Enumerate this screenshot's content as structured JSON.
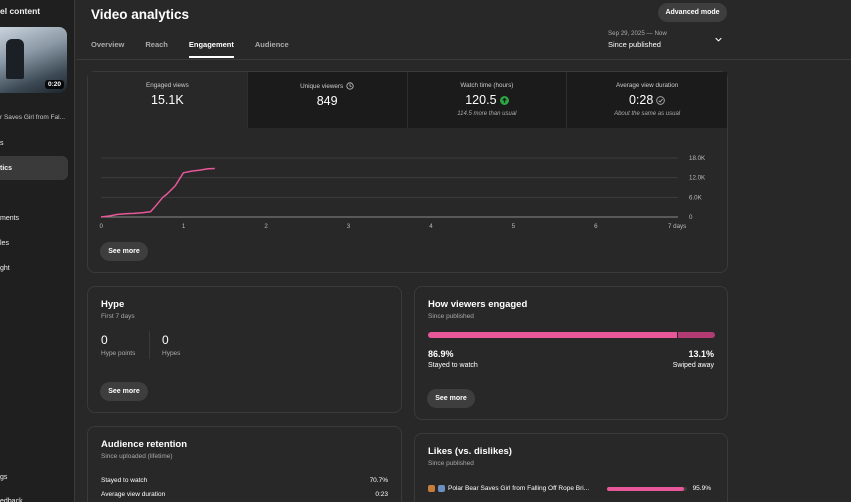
{
  "sidebar": {
    "title": "el content",
    "video_duration": "0:20",
    "video_title": "r Saves Girl from Fal...",
    "items": [
      {
        "label": "s"
      },
      {
        "label": "tics"
      },
      {
        "label": "ments"
      },
      {
        "label": "les"
      },
      {
        "label": "ght"
      },
      {
        "label": "gs"
      },
      {
        "label": "edback"
      }
    ]
  },
  "header": {
    "title": "Video analytics",
    "advanced_mode": "Advanced mode",
    "tabs": [
      "Overview",
      "Reach",
      "Engagement",
      "Audience"
    ],
    "active_tab": "Engagement",
    "date_range": "Sep 29, 2025 — Now",
    "date_label": "Since published"
  },
  "metrics": [
    {
      "label": "Engaged views",
      "value": "15.1K",
      "note": ""
    },
    {
      "label": "Unique viewers",
      "value": "849",
      "note": ""
    },
    {
      "label": "Watch time (hours)",
      "value": "120.5",
      "note": "114.5 more than usual"
    },
    {
      "label": "Average view duration",
      "value": "0:28",
      "note": "About the same as usual"
    }
  ],
  "chart_data": {
    "type": "line",
    "x": [
      0,
      0.1,
      0.2,
      0.3,
      0.4,
      0.5,
      0.6,
      0.65,
      0.7,
      0.75,
      0.8,
      0.9,
      1.0,
      1.1,
      1.2,
      1.3,
      1.38
    ],
    "y": [
      0,
      300,
      800,
      1000,
      1100,
      1300,
      1600,
      3000,
      4500,
      6000,
      7000,
      9500,
      13500,
      14000,
      14300,
      14700,
      14800
    ],
    "x_ticks": [
      "0",
      "1",
      "2",
      "3",
      "4",
      "5",
      "6",
      "7 days"
    ],
    "y_ticks": [
      "0",
      "6.0K",
      "12.0K",
      "18.0K"
    ],
    "xlim": [
      0,
      7
    ],
    "ylim": [
      0,
      18000
    ],
    "color": "#e8579a",
    "grid": true
  },
  "overview_more": "See more",
  "hype": {
    "title": "Hype",
    "subtitle": "First 7 days",
    "points_value": "0",
    "points_label": "Hype points",
    "hypes_value": "0",
    "hypes_label": "Hypes",
    "button": "See more"
  },
  "engaged": {
    "title": "How viewers engaged",
    "subtitle": "Since published",
    "stayed_pct": "86.9%",
    "stayed_label": "Stayed to watch",
    "stayed_fraction": 0.869,
    "swiped_pct": "13.1%",
    "swiped_label": "Swiped away",
    "button": "See more",
    "colors": {
      "stayed": "#e8579a",
      "swiped": "#b23b74"
    }
  },
  "retention": {
    "title": "Audience retention",
    "subtitle": "Since uploaded (lifetime)",
    "rows": [
      {
        "label": "Stayed to watch",
        "value": "70.7%"
      },
      {
        "label": "Average view duration",
        "value": "0:23"
      }
    ]
  },
  "likes": {
    "title": "Likes (vs. dislikes)",
    "subtitle": "Since published",
    "video_title": "Polar Bear Saves Girl from Falling Off Rope Bri...",
    "pct": "95.9%",
    "fraction": 0.959
  }
}
